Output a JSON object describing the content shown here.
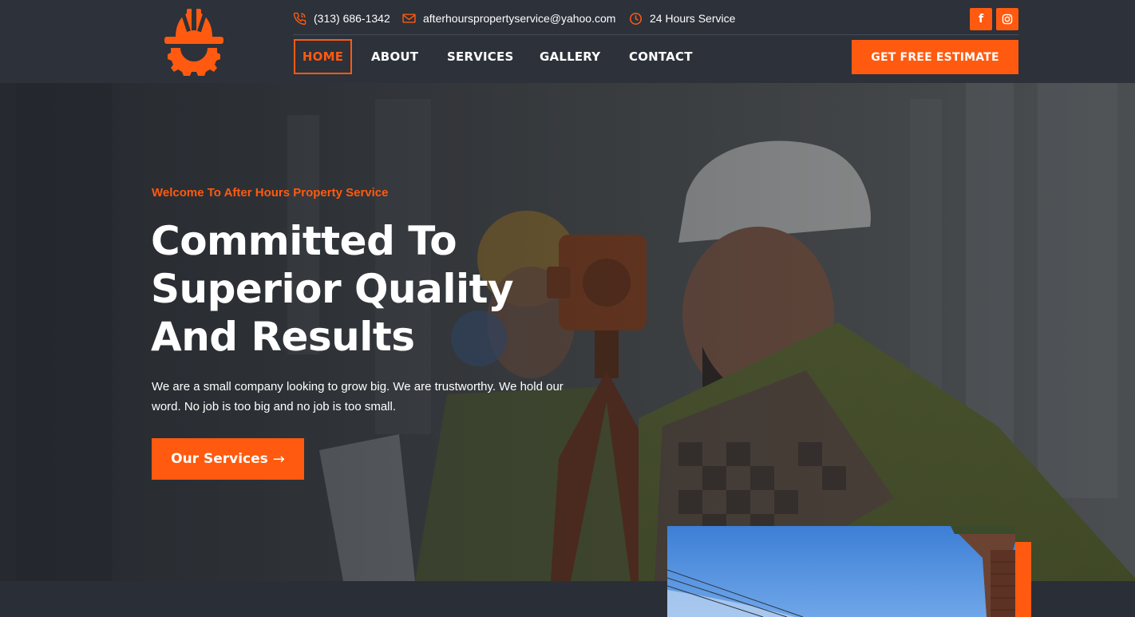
{
  "brand": {
    "logo_icon": "hardhat-gear-icon",
    "accent": "#ff5a0f",
    "header_bg": "#2c313a"
  },
  "topbar": {
    "phone": "(313) 686-1342",
    "email": "afterhourspropertyservice@yahoo.com",
    "hours": "24 Hours Service",
    "social": [
      "facebook-icon",
      "instagram-icon"
    ]
  },
  "nav": {
    "items": [
      {
        "label": "HOME",
        "active": true
      },
      {
        "label": "ABOUT",
        "active": false
      },
      {
        "label": "SERVICES",
        "active": false
      },
      {
        "label": "GALLERY",
        "active": false
      },
      {
        "label": "CONTACT",
        "active": false
      }
    ],
    "cta": "GET FREE ESTIMATE"
  },
  "hero": {
    "eyebrow": "Welcome To After Hours Property Service",
    "headline": "Committed To Superior Quality And Results",
    "lead": "We are a small company looking to grow big. We are trustworthy. We hold our word. No job is too big and no job is too small.",
    "button": "Our Services"
  }
}
